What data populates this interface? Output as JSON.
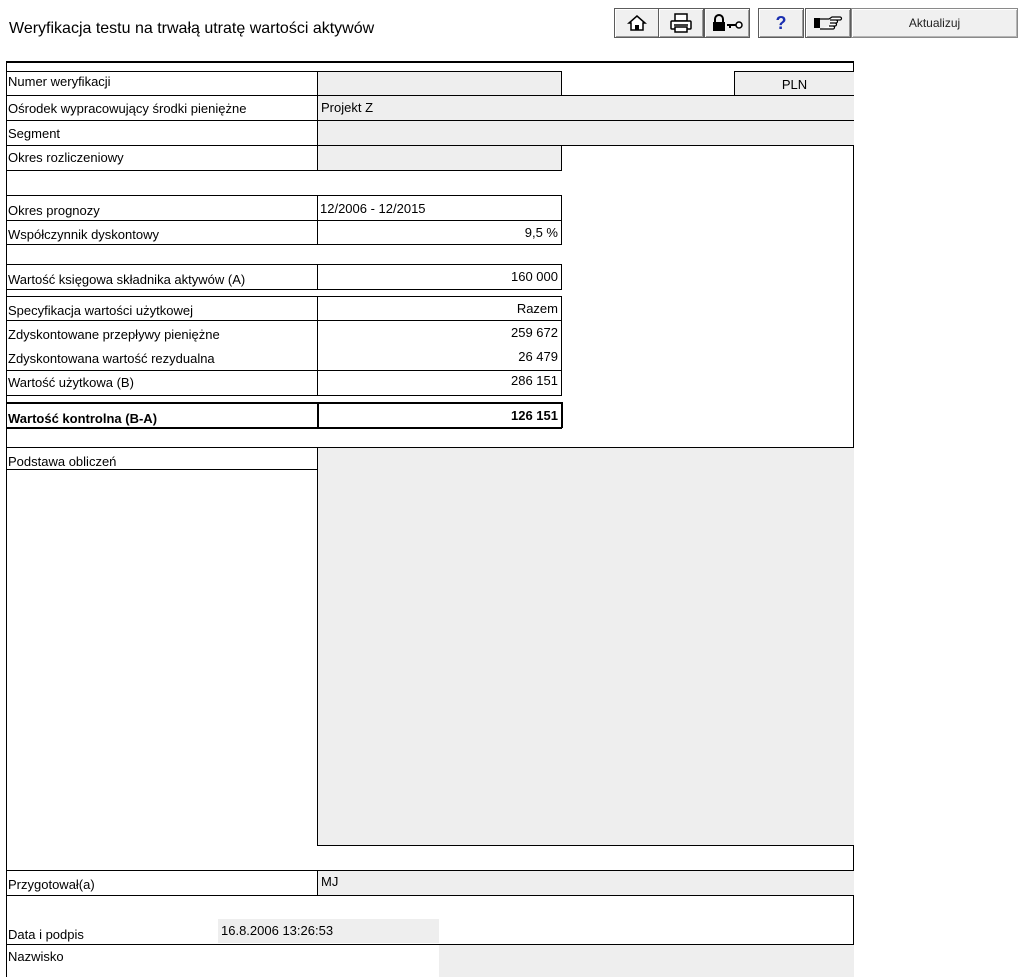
{
  "header": {
    "title": "Weryfikacja testu na trwałą utratę wartości aktywów",
    "update_button": "Aktualizuj",
    "icons": [
      "home-icon",
      "print-icon",
      "lock-key-icon",
      "help-icon",
      "pointing-hand-icon"
    ]
  },
  "form": {
    "verification_number": {
      "label": "Numer weryfikacji",
      "value": ""
    },
    "currency": "PLN",
    "cash_center": {
      "label": "Ośrodek wypracowujący środki pieniężne",
      "value": "Projekt Z"
    },
    "segment": {
      "label": "Segment",
      "value": ""
    },
    "period": {
      "label": "Okres rozliczeniowy",
      "value": ""
    },
    "forecast": {
      "label": "Okres prognozy",
      "value": "12/2006 - 12/2015"
    },
    "discount": {
      "label": "Współczynnik dyskontowy",
      "value": "9,5 %"
    },
    "book_value": {
      "label": "Wartość księgowa składnika aktywów (A)",
      "value": "160 000"
    },
    "spec": {
      "label": "Specyfikacja wartości użytkowej",
      "value": "Razem"
    },
    "cash_flows": {
      "label": "Zdyskontowane przepływy pieniężne",
      "value": "259 672"
    },
    "residual": {
      "label": "Zdyskontowana wartość rezydualna",
      "value": "26 479"
    },
    "use_value": {
      "label": "Wartość użytkowa (B)",
      "value": "286 151"
    },
    "control": {
      "label": "Wartość kontrolna (B-A)",
      "value": "126 151"
    },
    "basis": {
      "label": "Podstawa obliczeń",
      "value": ""
    },
    "prepared": {
      "label": "Przygotował(a)",
      "value": "MJ"
    },
    "date": {
      "label": "Data i podpis",
      "value": "16.8.2006 13:26:53"
    },
    "name": {
      "label": "Nazwisko",
      "value": ""
    }
  }
}
